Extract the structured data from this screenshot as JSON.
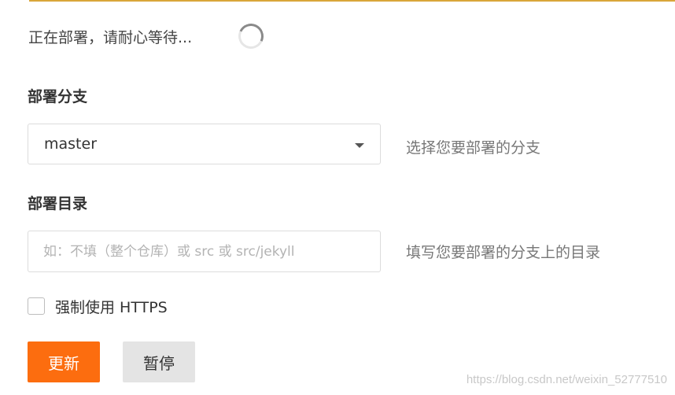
{
  "status": {
    "text": "正在部署，请耐心等待..."
  },
  "branch": {
    "label": "部署分支",
    "selected": "master",
    "hint": "选择您要部署的分支"
  },
  "directory": {
    "label": "部署目录",
    "placeholder": "如：不填（整个仓库）或 src 或 src/jekyll",
    "value": "",
    "hint": "填写您要部署的分支上的目录"
  },
  "https": {
    "label": "强制使用 HTTPS",
    "checked": false
  },
  "buttons": {
    "update": "更新",
    "pause": "暂停"
  },
  "watermark": "https://blog.csdn.net/weixin_52777510",
  "colors": {
    "primary": "#fc6d0f",
    "secondary": "#e4e4e4",
    "accent_rule": "#d9a63a"
  },
  "icons": {
    "spinner": "loading-spinner-icon",
    "dropdown": "caret-down-icon"
  }
}
